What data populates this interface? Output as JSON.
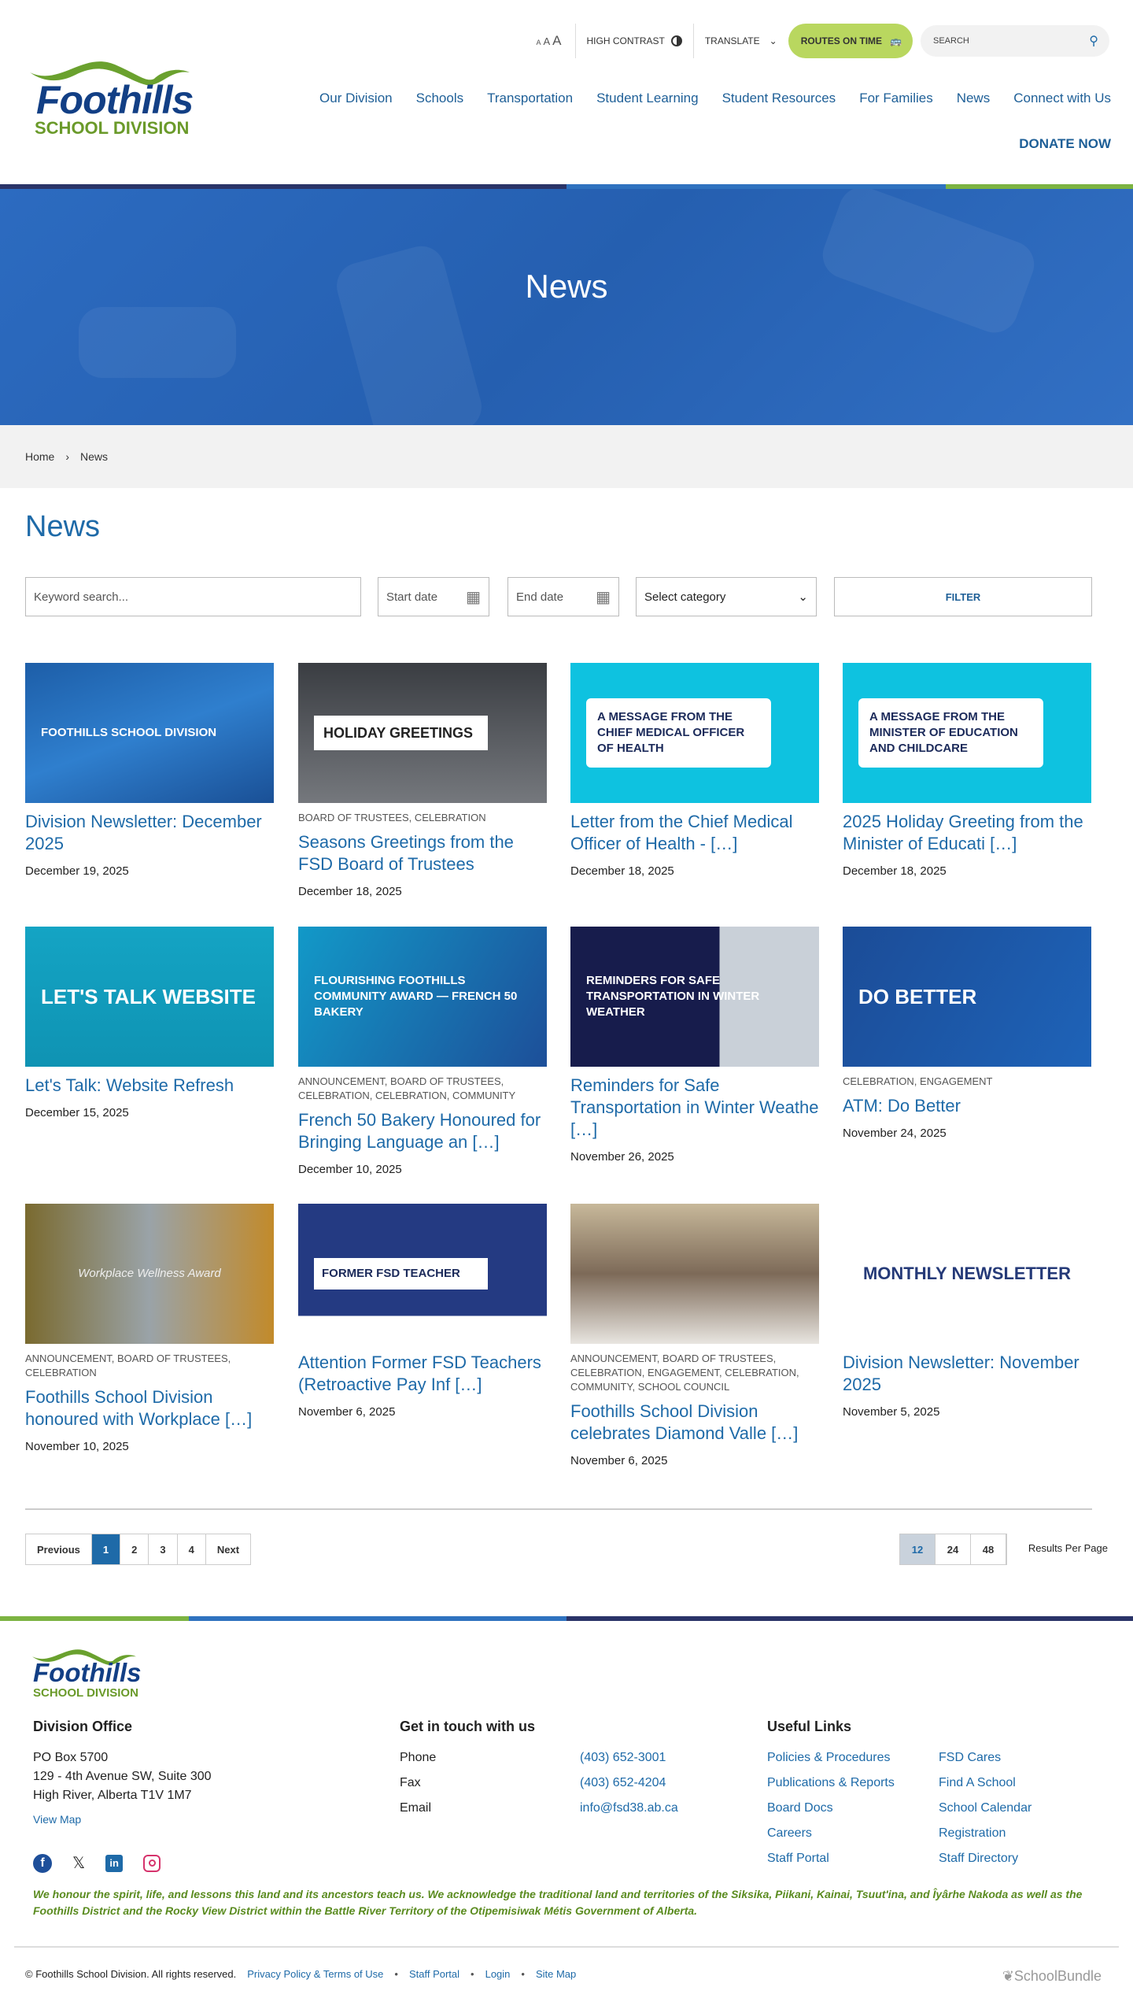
{
  "header": {
    "logo_text": "Foothills",
    "logo_sub": "SCHOOL DIVISION",
    "font_sizes": [
      "A",
      "A",
      "A"
    ],
    "high_contrast": "HIGH CONTRAST",
    "translate": "TRANSLATE",
    "routes": "ROUTES ON TIME",
    "search_placeholder": "SEARCH",
    "nav": [
      "Our Division",
      "Schools",
      "Transportation",
      "Student Learning",
      "Student Resources",
      "For Families",
      "News",
      "Connect with Us"
    ],
    "donate": "DONATE NOW"
  },
  "colors": {
    "navy": "#2a3468",
    "blue": "#1e6aa8",
    "green": "#7cb342",
    "lime": "#b9d75f"
  },
  "hero": {
    "title": "News"
  },
  "breadcrumb": [
    "Home",
    "News"
  ],
  "page_title": "News",
  "filters": {
    "keyword_placeholder": "Keyword search...",
    "start": "Start date",
    "end": "End date",
    "category": "Select category",
    "button": "FILTER"
  },
  "cards": [
    {
      "img": "FOOTHILLS SCHOOL DIVISION",
      "cat": "",
      "title": "Division Newsletter: December 2025",
      "date": "December 19, 2025"
    },
    {
      "img": "HOLIDAY GREETINGS",
      "cat": "BOARD OF TRUSTEES, CELEBRATION",
      "title": "Seasons Greetings from the FSD Board of Trustees",
      "date": "December 18, 2025"
    },
    {
      "img": "A MESSAGE FROM THE CHIEF MEDICAL OFFICER OF HEALTH",
      "cat": "",
      "title": "Letter from the Chief Medical Officer of Health - […]",
      "date": "December 18, 2025"
    },
    {
      "img": "A MESSAGE FROM THE MINISTER OF EDUCATION AND CHILDCARE",
      "cat": "",
      "title": "2025 Holiday Greeting from the Minister of Educati […]",
      "date": "December 18, 2025"
    },
    {
      "img": "LET'S TALK WEBSITE",
      "cat": "",
      "title": "Let's Talk: Website Refresh",
      "date": "December 15, 2025"
    },
    {
      "img": "FLOURISHING FOOTHILLS COMMUNITY AWARD — FRENCH 50 BAKERY",
      "cat": "ANNOUNCEMENT, BOARD OF TRUSTEES, CELEBRATION, CELEBRATION, COMMUNITY",
      "title": "French 50 Bakery Honoured for Bringing Language an […]",
      "date": "December 10, 2025"
    },
    {
      "img": "REMINDERS FOR SAFE TRANSPORTATION IN WINTER WEATHER",
      "cat": "",
      "title": "Reminders for Safe Transportation in Winter Weathe […]",
      "date": "November 26, 2025"
    },
    {
      "img": "DO BETTER",
      "cat": "CELEBRATION, ENGAGEMENT",
      "title": "ATM: Do Better",
      "date": "November 24, 2025"
    },
    {
      "img": "Workplace Wellness Award",
      "cat": "ANNOUNCEMENT, BOARD OF TRUSTEES, CELEBRATION",
      "title": "Foothills School Division honoured with Workplace […]",
      "date": "November 10, 2025"
    },
    {
      "img": "FORMER FSD TEACHER",
      "cat": "",
      "title": "Attention Former FSD Teachers (Retroactive Pay Inf […]",
      "date": "November 6, 2025"
    },
    {
      "img": "",
      "cat": "ANNOUNCEMENT, BOARD OF TRUSTEES, CELEBRATION, ENGAGEMENT, CELEBRATION, COMMUNITY, SCHOOL COUNCIL",
      "title": "Foothills School Division celebrates Diamond Valle […]",
      "date": "November 6, 2025"
    },
    {
      "img": "MONTHLY NEWSLETTER",
      "cat": "",
      "title": "Division Newsletter: November 2025",
      "date": "November 5, 2025"
    }
  ],
  "pagination": {
    "prev": "Previous",
    "pages": [
      "1",
      "2",
      "3",
      "4"
    ],
    "next": "Next",
    "per_page": [
      "12",
      "24",
      "48"
    ],
    "per_page_label": "Results Per Page"
  },
  "footer": {
    "office_title": "Division Office",
    "address": [
      "PO Box 5700",
      "129 - 4th Avenue SW, Suite 300",
      "High River, Alberta T1V 1M7"
    ],
    "view_map": "View Map",
    "contact_title": "Get in touch with us",
    "contact": [
      {
        "label": "Phone",
        "value": "(403) 652-3001"
      },
      {
        "label": "Fax",
        "value": "(403) 652-4204"
      },
      {
        "label": "Email",
        "value": "info@fsd38.ab.ca"
      }
    ],
    "links_title": "Useful Links",
    "links_a": [
      "Policies & Procedures",
      "Publications & Reports",
      "Board Docs",
      "Careers",
      "Staff Portal"
    ],
    "links_b": [
      "FSD Cares",
      "Find A School",
      "School Calendar",
      "Registration",
      "Staff Directory"
    ],
    "ack": "We honour the spirit, life, and lessons this land and its ancestors teach us. We acknowledge the traditional land and territories of the Siksika, Piikani, Kainai, Tsuut'ina, and Îyârhe Nakoda as well as the Foothills District and the Rocky View District within the Battle River Territory of the Otipemisiwak Métis Government of Alberta.",
    "copyright": "© Foothills School Division. All rights reserved.",
    "bottom_links": [
      "Privacy Policy & Terms of Use",
      "Staff Portal",
      "Login",
      "Site Map"
    ],
    "brand": "SchoolBundle"
  }
}
